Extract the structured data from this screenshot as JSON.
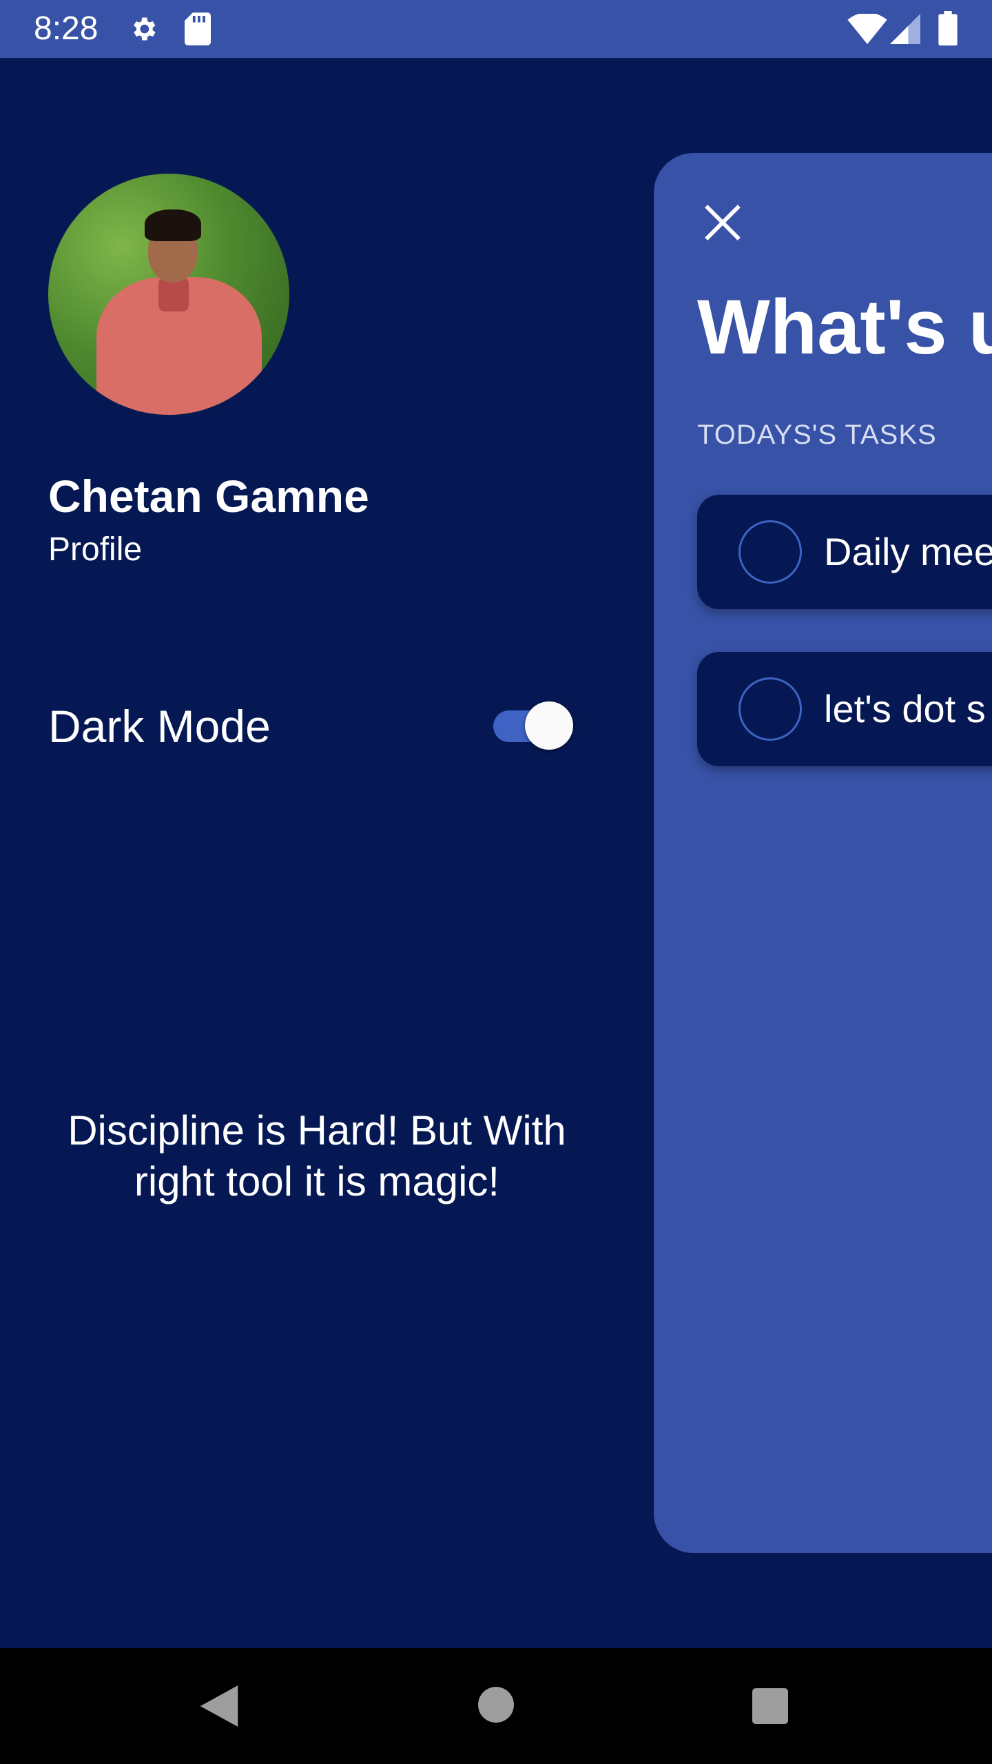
{
  "status_bar": {
    "time": "8:28",
    "icons": [
      "gear-icon",
      "sd-card-icon",
      "wifi-icon",
      "signal-icon",
      "battery-icon"
    ]
  },
  "drawer": {
    "profile_name": "Chetan Gamne",
    "profile_link": "Profile",
    "dark_mode_label": "Dark Mode",
    "dark_mode_on": true,
    "quote": "Discipline is Hard! But With right tool it is magic!"
  },
  "main": {
    "title": "What's up",
    "tasks_header": "TODAYS'S TASKS",
    "tasks": [
      {
        "text": "Daily meet",
        "done": false
      },
      {
        "text": "let's dot s",
        "done": false
      }
    ]
  },
  "nav_bar": {
    "icons": [
      "back-icon",
      "home-icon",
      "recent-apps-icon"
    ]
  },
  "colors": {
    "background": "#051853",
    "panel": "#3752a6",
    "accent": "#3e63c4",
    "text": "#ffffff"
  }
}
